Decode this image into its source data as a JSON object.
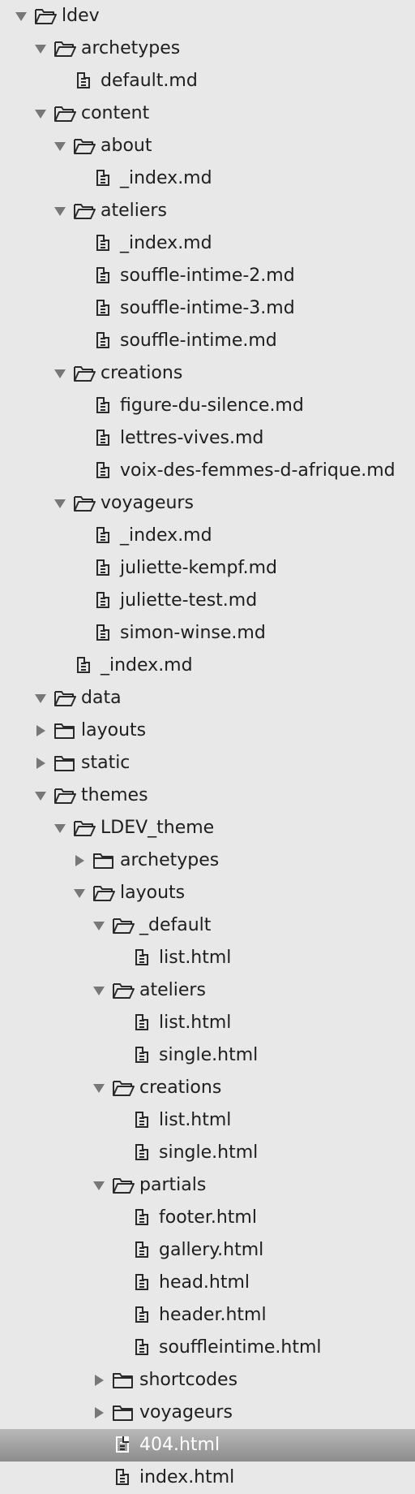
{
  "tree": [
    {
      "label": "ldev",
      "kind": "folder",
      "state": "expanded",
      "depth": 0
    },
    {
      "label": "archetypes",
      "kind": "folder",
      "state": "expanded",
      "depth": 1
    },
    {
      "label": "default.md",
      "kind": "file",
      "depth": 2
    },
    {
      "label": "content",
      "kind": "folder",
      "state": "expanded",
      "depth": 1
    },
    {
      "label": "about",
      "kind": "folder",
      "state": "expanded",
      "depth": 2
    },
    {
      "label": "_index.md",
      "kind": "file",
      "depth": 3
    },
    {
      "label": "ateliers",
      "kind": "folder",
      "state": "expanded",
      "depth": 2
    },
    {
      "label": "_index.md",
      "kind": "file",
      "depth": 3
    },
    {
      "label": "souffle-intime-2.md",
      "kind": "file",
      "depth": 3
    },
    {
      "label": "souffle-intime-3.md",
      "kind": "file",
      "depth": 3
    },
    {
      "label": "souffle-intime.md",
      "kind": "file",
      "depth": 3
    },
    {
      "label": "creations",
      "kind": "folder",
      "state": "expanded",
      "depth": 2
    },
    {
      "label": "figure-du-silence.md",
      "kind": "file",
      "depth": 3
    },
    {
      "label": "lettres-vives.md",
      "kind": "file",
      "depth": 3
    },
    {
      "label": "voix-des-femmes-d-afrique.md",
      "kind": "file",
      "depth": 3
    },
    {
      "label": "voyageurs",
      "kind": "folder",
      "state": "expanded",
      "depth": 2
    },
    {
      "label": "_index.md",
      "kind": "file",
      "depth": 3
    },
    {
      "label": "juliette-kempf.md",
      "kind": "file",
      "depth": 3
    },
    {
      "label": "juliette-test.md",
      "kind": "file",
      "depth": 3
    },
    {
      "label": "simon-winse.md",
      "kind": "file",
      "depth": 3
    },
    {
      "label": "_index.md",
      "kind": "file",
      "depth": 2
    },
    {
      "label": "data",
      "kind": "folder",
      "state": "expanded",
      "depth": 1
    },
    {
      "label": "layouts",
      "kind": "folder",
      "state": "collapsed",
      "depth": 1
    },
    {
      "label": "static",
      "kind": "folder",
      "state": "collapsed",
      "depth": 1
    },
    {
      "label": "themes",
      "kind": "folder",
      "state": "expanded",
      "depth": 1
    },
    {
      "label": "LDEV_theme",
      "kind": "folder",
      "state": "expanded",
      "depth": 2
    },
    {
      "label": "archetypes",
      "kind": "folder",
      "state": "collapsed",
      "depth": 3
    },
    {
      "label": "layouts",
      "kind": "folder",
      "state": "expanded",
      "depth": 3
    },
    {
      "label": "_default",
      "kind": "folder",
      "state": "expanded",
      "depth": 4
    },
    {
      "label": "list.html",
      "kind": "file",
      "depth": 5
    },
    {
      "label": "ateliers",
      "kind": "folder",
      "state": "expanded",
      "depth": 4
    },
    {
      "label": "list.html",
      "kind": "file",
      "depth": 5
    },
    {
      "label": "single.html",
      "kind": "file",
      "depth": 5
    },
    {
      "label": "creations",
      "kind": "folder",
      "state": "expanded",
      "depth": 4
    },
    {
      "label": "list.html",
      "kind": "file",
      "depth": 5
    },
    {
      "label": "single.html",
      "kind": "file",
      "depth": 5
    },
    {
      "label": "partials",
      "kind": "folder",
      "state": "expanded",
      "depth": 4
    },
    {
      "label": "footer.html",
      "kind": "file",
      "depth": 5
    },
    {
      "label": "gallery.html",
      "kind": "file",
      "depth": 5
    },
    {
      "label": "head.html",
      "kind": "file",
      "depth": 5
    },
    {
      "label": "header.html",
      "kind": "file",
      "depth": 5
    },
    {
      "label": "soufflеintime.html",
      "kind": "file",
      "depth": 5
    },
    {
      "label": "shortcodes",
      "kind": "folder",
      "state": "collapsed",
      "depth": 4
    },
    {
      "label": "voyageurs",
      "kind": "folder",
      "state": "collapsed",
      "depth": 4
    },
    {
      "label": "404.html",
      "kind": "file",
      "depth": 4,
      "selected": true
    },
    {
      "label": "index.html",
      "kind": "file",
      "depth": 4
    }
  ]
}
